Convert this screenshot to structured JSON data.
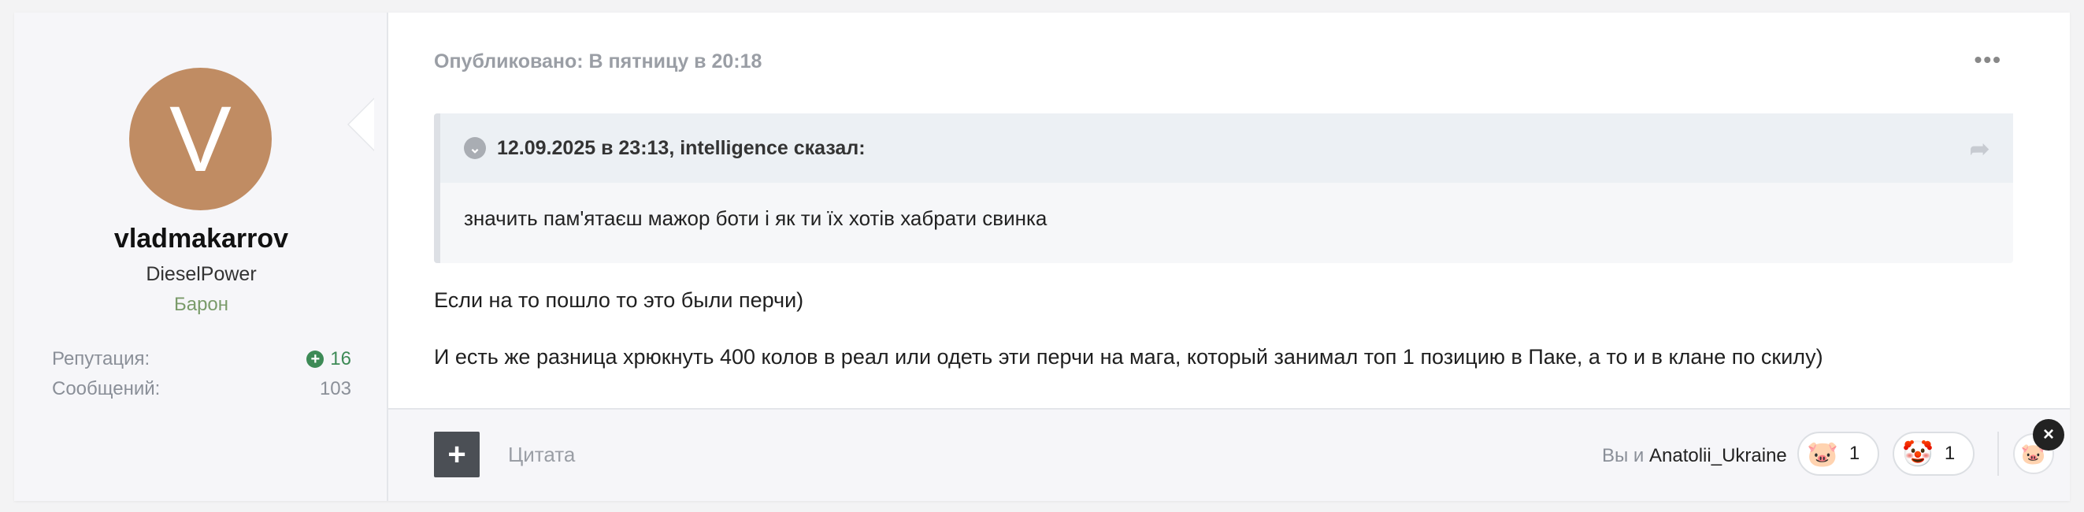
{
  "author": {
    "avatar_letter": "V",
    "username": "vladmakarrov",
    "subtitle": "DieselPower",
    "rank": "Барон",
    "reputation_label": "Репутация:",
    "reputation_value": "16",
    "messages_label": "Сообщений:",
    "messages_value": "103"
  },
  "post": {
    "meta": "Опубликовано: В пятницу в 20:18",
    "more_label": "•••",
    "quote_header": "12.09.2025 в 23:13, intelligence сказал:",
    "quote_body": "значить пам'ятаєш мажор боти і як ти їх хотів хабрати свинка",
    "paragraphs": [
      "Если на то пошло то это были перчи)",
      "И есть же разница хрюкнуть 400 колов в реал или одеть эти перчи на мага, который занимал топ 1 позицию в Паке, а то и в клане по скилу)"
    ]
  },
  "footer": {
    "quote_button_label": "Цитата",
    "reactions_prefix": "Вы и ",
    "reactions_user": "Anatolii_Ukraine",
    "reactions": [
      {
        "icon": "pig-face-icon",
        "glyph": "🐷",
        "count": "1"
      },
      {
        "icon": "clown-face-icon",
        "glyph": "🤡",
        "count": "1"
      }
    ],
    "my_reaction_glyph": "🐷"
  },
  "colors": {
    "avatar_bg": "#c08c63",
    "rank": "#7a9b6a",
    "reputation": "#3d8a56"
  }
}
